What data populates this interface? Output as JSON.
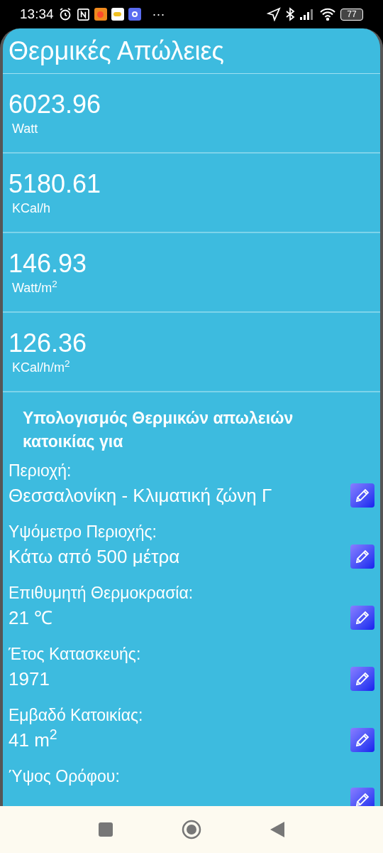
{
  "status_bar": {
    "time": "13:34",
    "more": "···",
    "battery": "77"
  },
  "title": "Θερμικές Απώλειες",
  "results": [
    {
      "value": "6023.96",
      "unit": "Watt"
    },
    {
      "value": "5180.61",
      "unit": "KCal/h"
    },
    {
      "value": "146.93",
      "unit": "Watt/m$^{2}$"
    },
    {
      "value": "126.36",
      "unit": "KCal/h/m$^{2}$"
    }
  ],
  "section_heading": "Υπολογισμός Θερμικών απωλειών κατοικίας για",
  "parameters": [
    {
      "label": "Περιοχή:",
      "value": "Θεσσαλονίκη - Κλιματική ζώνη Γ"
    },
    {
      "label": "Υψόμετρο Περιοχής:",
      "value": "Κάτω από 500 μέτρα"
    },
    {
      "label": "Επιθυμητή Θερμοκρασία:",
      "value": "21 ℃"
    },
    {
      "label": "Έτος Κατασκευής:",
      "value": "1971"
    },
    {
      "label": "Εμβαδό Κατοικίας:",
      "value": "41 m$^{2}$"
    },
    {
      "label": "Ύψος Ορόφου:"
    }
  ]
}
